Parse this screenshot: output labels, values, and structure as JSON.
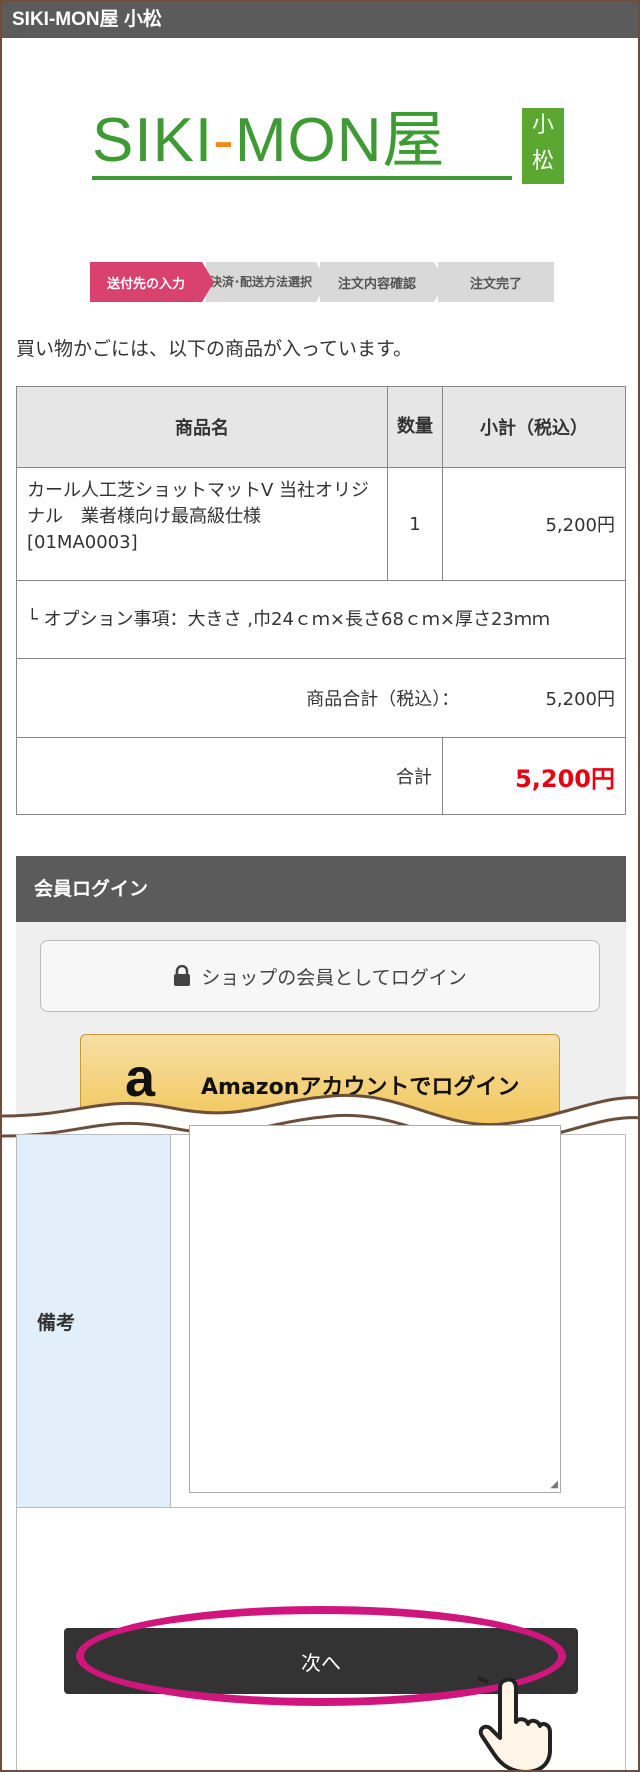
{
  "header": {
    "title": "SIKI-MON屋 小松"
  },
  "logo": {
    "part1": "SIKI",
    "part2": "-",
    "part3": "MON",
    "kanji": "屋",
    "sub1": "小",
    "sub2": "松"
  },
  "steps": [
    {
      "label": "送付先の入力"
    },
    {
      "label": "決済･配送方法選択"
    },
    {
      "label": "注文内容確認"
    },
    {
      "label": "注文完了"
    }
  ],
  "cart": {
    "intro": "買い物かごには、以下の商品が入っています。",
    "headers": {
      "name": "商品名",
      "qty": "数量",
      "subtotal": "小計（税込）"
    },
    "item": {
      "name": "カール人工芝ショットマットV 当社オリジナル　業者様向け最高級仕様 [01MA0003]",
      "qty": "1",
      "subtotal": "5,200円"
    },
    "option": "└ オプション事項：大きさ ,巾24ｃｍ×長さ68ｃｍ×厚さ23ｍｍ",
    "goods_total_label": "商品合計（税込）：",
    "goods_total_value": "5,200円",
    "total_label": "合計",
    "total_value": "5,200円"
  },
  "login": {
    "title": "会員ログイン",
    "shop_login_label": "ショップの会員としてログイン",
    "amazon_label": "Amazonアカウントでログイン"
  },
  "remarks": {
    "label": "備考",
    "value": ""
  },
  "next_button": {
    "label": "次へ"
  },
  "icons": [
    "lock-icon",
    "amazon-logo-icon",
    "pointing-hand-icon",
    "resize-grip-icon"
  ],
  "colors": {
    "header_bg": "#5b5b5b",
    "active_step": "#d9416f",
    "total_red": "#e60012",
    "highlight": "#d0167e",
    "logo_green": "#3e9a33"
  }
}
